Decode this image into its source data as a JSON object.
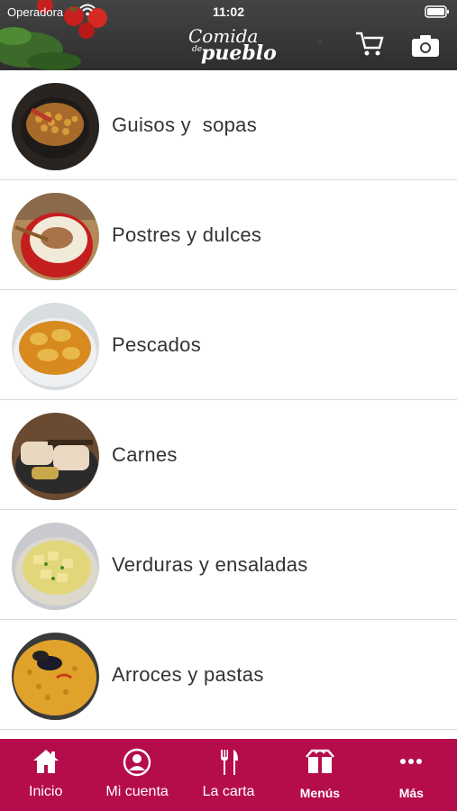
{
  "status_bar": {
    "carrier": "Operadora",
    "time": "11:02"
  },
  "header": {
    "logo_line1": "Comida",
    "logo_de": "de",
    "logo_line2": "pueblo",
    "icons": [
      "cart-icon",
      "camera-icon"
    ]
  },
  "categories": [
    {
      "label": "Guisos y  sopas",
      "image": "chickpea-stew-photo"
    },
    {
      "label": "Postres y dulces",
      "image": "rice-pudding-photo"
    },
    {
      "label": "Pescados",
      "image": "fish-stew-photo"
    },
    {
      "label": "Carnes",
      "image": "roast-meat-photo"
    },
    {
      "label": "Verduras y ensaladas",
      "image": "potato-salad-photo"
    },
    {
      "label": "Arroces y pastas",
      "image": "paella-photo"
    }
  ],
  "tabbar": {
    "items": [
      {
        "label": "Inicio",
        "icon": "home-icon"
      },
      {
        "label": "Mi cuenta",
        "icon": "user-icon"
      },
      {
        "label": "La carta",
        "icon": "fork-knife-icon"
      },
      {
        "label": "Menús",
        "icon": "box-icon"
      },
      {
        "label": "Más",
        "icon": "more-icon"
      }
    ]
  },
  "colors": {
    "accent": "#b50d4b",
    "header_bg": "#3a3a3a",
    "text": "#333333"
  }
}
